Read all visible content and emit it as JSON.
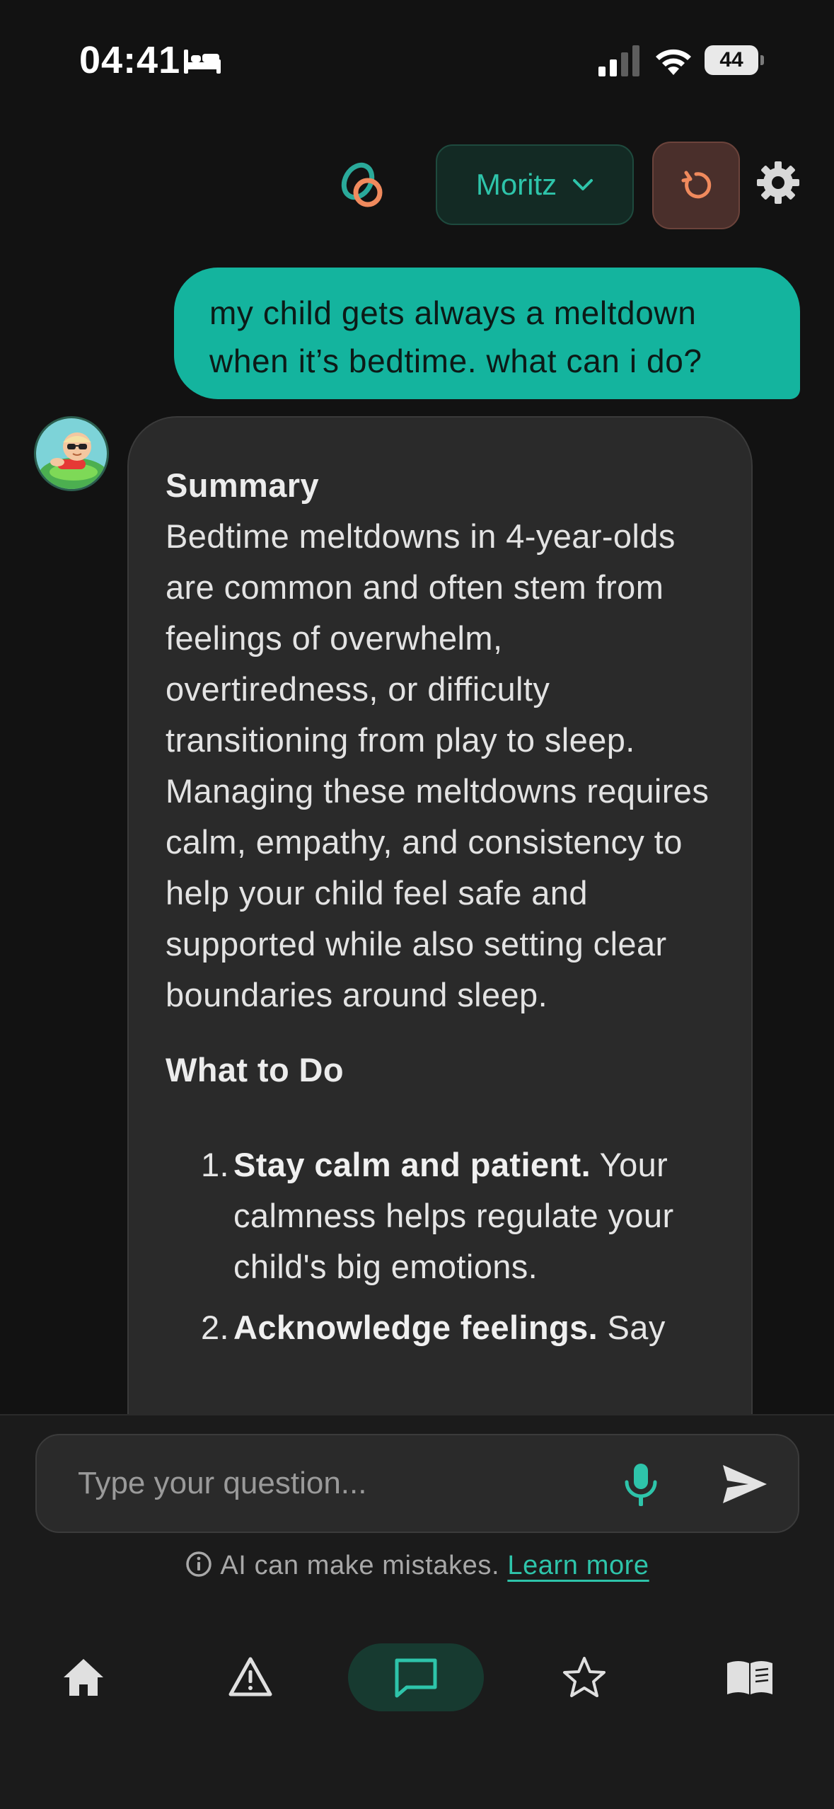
{
  "status_bar": {
    "time": "04:41",
    "battery": "44"
  },
  "header": {
    "profile_name": "Moritz"
  },
  "conversation": {
    "user_message": "my child gets always a meltdown when it’s bedtime. what can i do?",
    "assistant": {
      "summary_heading": "Summary",
      "summary_text": "Bedtime meltdowns in 4-year-olds are common and often stem from feelings of overwhelm, overtiredness, or difficulty transitioning from play to sleep. Managing these meltdowns requires calm, empathy, and consistency to help your child feel safe and supported while also setting clear boundaries around sleep.",
      "what_to_do_heading": "What to Do",
      "steps": [
        {
          "number": "1.",
          "title": "Stay calm and patient.",
          "text": " Your calmness helps regulate your child's big emotions."
        },
        {
          "number": "2.",
          "title": "Acknowledge feelings.",
          "text": " Say"
        }
      ]
    }
  },
  "input": {
    "placeholder": "Type your question..."
  },
  "disclaimer": {
    "text": "AI can make mistakes.",
    "link": "Learn more"
  },
  "nav": {
    "items": [
      "home-icon",
      "warning-icon",
      "chat-icon",
      "star-icon",
      "book-icon"
    ],
    "active": "chat-icon"
  },
  "colors": {
    "accent": "#14b49e",
    "background": "#121212",
    "bubble": "#2a2a2a"
  }
}
